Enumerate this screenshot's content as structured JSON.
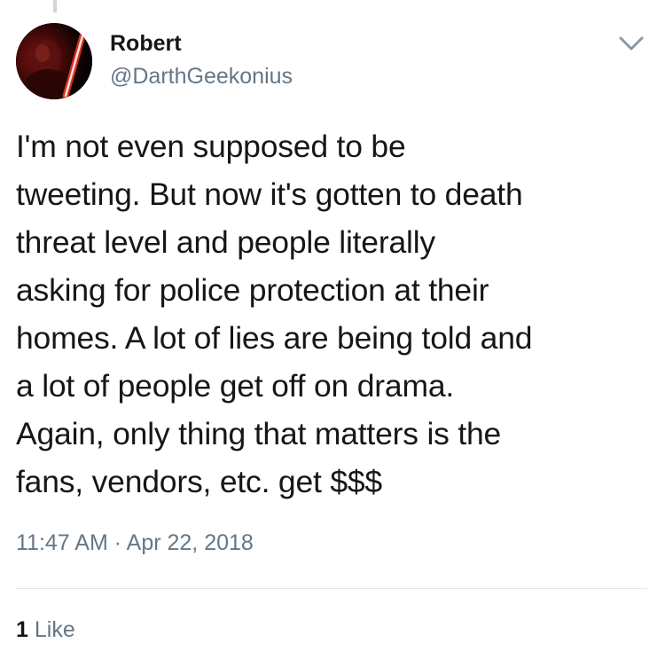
{
  "author": {
    "name": "Robert",
    "handle": "@DarthGeekonius"
  },
  "tweet": {
    "lines": [
      "I'm not even supposed to be",
      "tweeting. But now it's gotten to death",
      "threat level and people literally",
      "asking for police protection at their",
      "homes. A lot of lies are being told and",
      "a lot of people get off on drama.",
      "Again, only thing that matters is the",
      "fans, vendors, etc. get $$$"
    ],
    "time": "11:47 AM",
    "separator": "·",
    "date": "Apr 22, 2018"
  },
  "engagement": {
    "like_count": "1",
    "like_label": "Like"
  },
  "icons": {
    "avatar": "avatar-lightsaber-image",
    "menu": "chevron-down-icon"
  },
  "colors": {
    "text": "#14171a",
    "secondary": "#657786",
    "divider": "#e1e8ed"
  }
}
